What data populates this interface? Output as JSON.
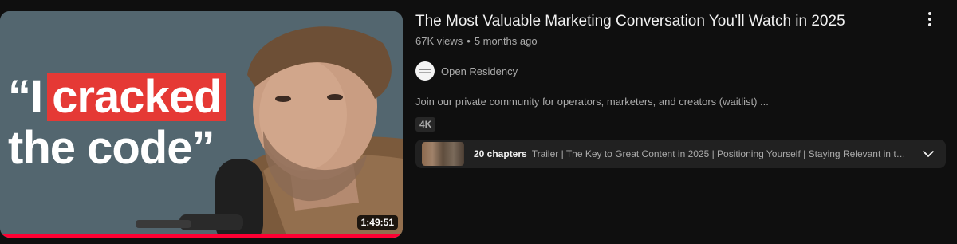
{
  "video": {
    "title": "The Most Valuable Marketing Conversation You’ll Watch in 2025",
    "views": "67K views",
    "age": "5 months ago",
    "duration": "1:49:51",
    "progress_percent": 100,
    "description": "Join our private community for operators, marketers, and creators (waitlist) ...",
    "badge": "4K"
  },
  "thumbnail": {
    "line1_prefix": "“I",
    "line1_highlight": "cracked",
    "line2": "the code”",
    "highlight_color": "#e53935"
  },
  "channel": {
    "name": "Open Residency",
    "avatar_icon": "channel-logo-icon"
  },
  "chapters": {
    "count_label": "20 chapters",
    "titles": "Trailer | The Key to Great Content in 2025 | Positioning Yourself | Staying Relevant in the Age of AI"
  },
  "icons": {
    "more": "more-vertical-icon",
    "expand": "chevron-down-icon"
  }
}
